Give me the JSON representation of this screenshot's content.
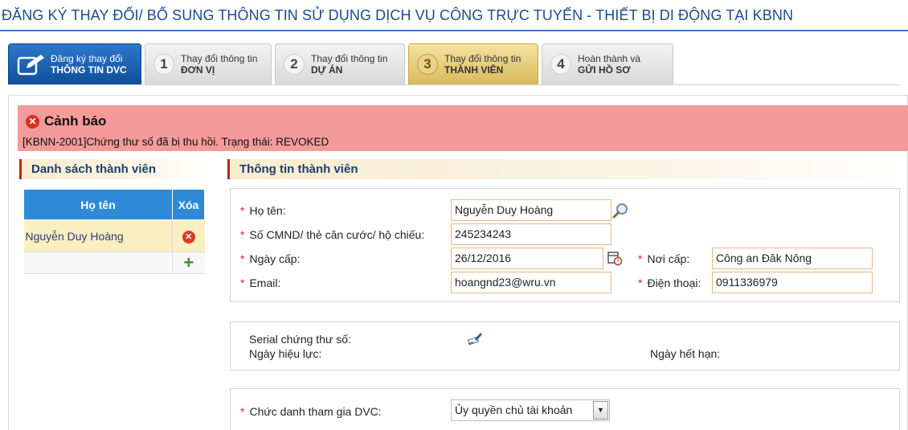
{
  "page": {
    "title": "ĐĂNG KÝ THAY ĐỔI/ BỔ SUNG THÔNG TIN SỬ DỤNG DỊCH VỤ CÔNG TRỰC TUYẾN - THIẾT BỊ DI ĐỘNG TẠI KBNN"
  },
  "steps": [
    {
      "line1": "Đăng ký thay đổi",
      "line2": "THÔNG TIN DVC"
    },
    {
      "num": "1",
      "line1": "Thay đổi thông tin",
      "line2": "ĐƠN VỊ"
    },
    {
      "num": "2",
      "line1": "Thay đổi thông tin",
      "line2": "DỰ ÁN"
    },
    {
      "num": "3",
      "line1": "Thay đổi thông tin",
      "line2": "THÀNH VIÊN"
    },
    {
      "num": "4",
      "line1": "Hoàn thành và",
      "line2": "GỬI HỒ SƠ"
    }
  ],
  "alert": {
    "title": "Cảnh báo",
    "message": "[KBNN-2001]Chứng thư số đã bị thu hồi. Trạng thái: REVOKED",
    "color": "#f59a9a"
  },
  "member_list": {
    "heading": "Danh sách thành viên",
    "columns": [
      "Họ tên",
      "Xóa"
    ],
    "rows": [
      {
        "name": "Nguyễn Duy Hoàng"
      }
    ]
  },
  "member_info": {
    "heading": "Thông tin thành viên",
    "full_name": {
      "label": "Họ tên:",
      "value": "Nguyễn Duy Hoàng"
    },
    "id_number": {
      "label": "Số CMND/ thẻ căn cước/ hộ chiếu:",
      "value": "245234243"
    },
    "issue_date": {
      "label": "Ngày cấp:",
      "value": "26/12/2016"
    },
    "issue_place": {
      "label": "Nơi cấp:",
      "value": "Công an Đăk Nông"
    },
    "email": {
      "label": "Email:",
      "value": "hoangnd23@wru.vn"
    },
    "phone": {
      "label": "Điện thoại:",
      "value": "0911336979"
    }
  },
  "certificate": {
    "serial_label": "Serial chứng thư số:",
    "valid_from_label": "Ngày hiệu lực:",
    "expiry_label": "Ngày hết hạn:"
  },
  "role": {
    "label": "Chức danh tham gia DVC:",
    "selected": "Ủy quyền chủ tài khoản"
  },
  "colors": {
    "brand_blue": "#1a4c8c",
    "table_header": "#2e8ad6",
    "active_step": "#d9b95a",
    "required": "#d9261a"
  }
}
